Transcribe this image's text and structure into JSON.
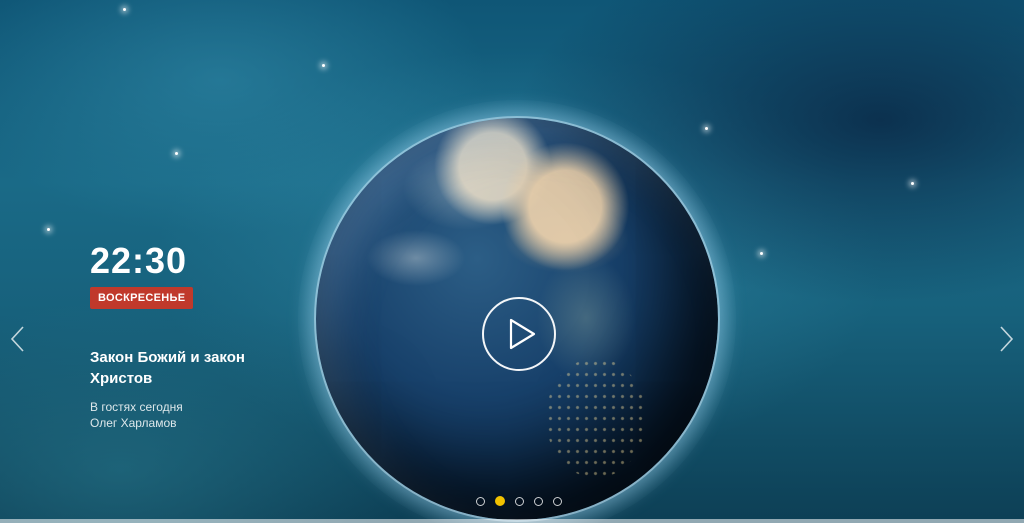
{
  "slide": {
    "time": "22:30",
    "day": "Воскресенье",
    "title": "Закон Божий и закон Христов",
    "subtitle_line1": "В гостях сегодня",
    "subtitle_line2": "Олег Харламов"
  },
  "controls": {
    "prev_icon": "chevron-left-icon",
    "next_icon": "chevron-right-icon",
    "play_icon": "play-icon"
  },
  "pagination": {
    "total": 5,
    "active_index": 1
  },
  "colors": {
    "badge": "#c0392b",
    "active_dot": "#f2c200",
    "text": "#ffffff"
  }
}
